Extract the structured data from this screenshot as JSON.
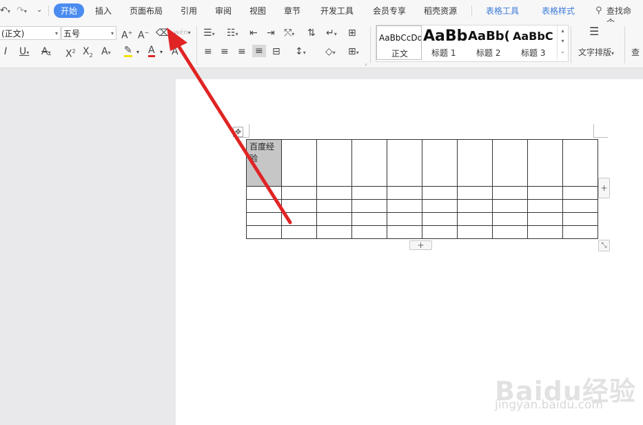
{
  "tabs": {
    "start": "开始",
    "insert": "插入",
    "layout": "页面布局",
    "reference": "引用",
    "review": "审阅",
    "view": "视图",
    "chapter": "章节",
    "dev": "开发工具",
    "member": "会员专享",
    "resources": "稻壳资源",
    "table_tools": "表格工具",
    "table_style": "表格样式",
    "search": "查找命令、"
  },
  "font": {
    "name": "(正文)",
    "size": "五号"
  },
  "style_gallery": [
    {
      "preview": "AaBbCcDd",
      "caption": "正文"
    },
    {
      "preview": "AaBb",
      "caption": "标题 1"
    },
    {
      "preview": "AaBb(",
      "caption": "标题 2"
    },
    {
      "preview": "AaBbC",
      "caption": "标题 3"
    }
  ],
  "text_layout_label": "文字排版",
  "find_label": "查",
  "table": {
    "header_cell": "百度经验",
    "cols": 10,
    "rows": 5
  },
  "watermark": {
    "logo": "Baidu经验",
    "url": "jingyan.baidu.com"
  },
  "colors": {
    "accent": "#4a8cf0",
    "arrow": "#e02424",
    "header_cell_bg": "#c6c6c6"
  }
}
